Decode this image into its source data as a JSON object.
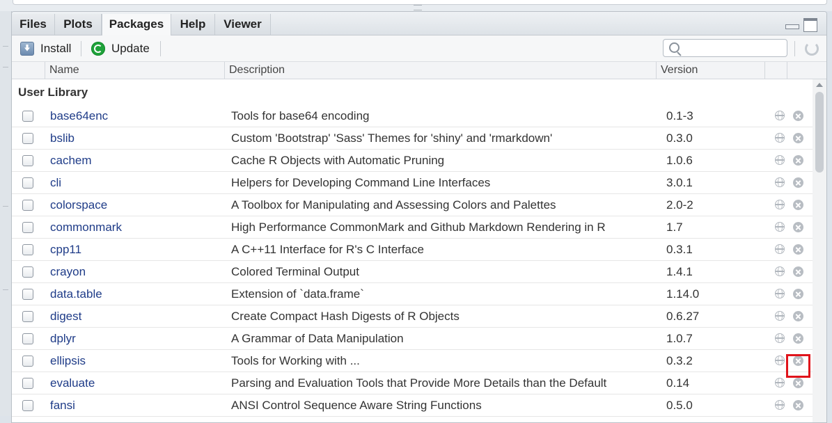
{
  "tabs": [
    "Files",
    "Plots",
    "Packages",
    "Help",
    "Viewer"
  ],
  "active_tab": "Packages",
  "toolbar": {
    "install_label": "Install",
    "update_label": "Update",
    "search_placeholder": ""
  },
  "columns": {
    "name": "Name",
    "description": "Description",
    "version": "Version"
  },
  "library_label": "User Library",
  "packages": [
    {
      "name": "base64enc",
      "description": "Tools for base64 encoding",
      "version": "0.1-3"
    },
    {
      "name": "bslib",
      "description": "Custom 'Bootstrap' 'Sass' Themes for 'shiny' and 'rmarkdown'",
      "version": "0.3.0"
    },
    {
      "name": "cachem",
      "description": "Cache R Objects with Automatic Pruning",
      "version": "1.0.6"
    },
    {
      "name": "cli",
      "description": "Helpers for Developing Command Line Interfaces",
      "version": "3.0.1"
    },
    {
      "name": "colorspace",
      "description": "A Toolbox for Manipulating and Assessing Colors and Palettes",
      "version": "2.0-2"
    },
    {
      "name": "commonmark",
      "description": "High Performance CommonMark and Github Markdown Rendering in R",
      "version": "1.7"
    },
    {
      "name": "cpp11",
      "description": "A C++11 Interface for R's C Interface",
      "version": "0.3.1"
    },
    {
      "name": "crayon",
      "description": "Colored Terminal Output",
      "version": "1.4.1"
    },
    {
      "name": "data.table",
      "description": "Extension of `data.frame`",
      "version": "1.14.0"
    },
    {
      "name": "digest",
      "description": "Create Compact Hash Digests of R Objects",
      "version": "0.6.27"
    },
    {
      "name": "dplyr",
      "description": "A Grammar of Data Manipulation",
      "version": "1.0.7"
    },
    {
      "name": "ellipsis",
      "description": "Tools for Working with ...",
      "version": "0.3.2"
    },
    {
      "name": "evaluate",
      "description": "Parsing and Evaluation Tools that Provide More Details than the Default",
      "version": "0.14"
    },
    {
      "name": "fansi",
      "description": "ANSI Control Sequence Aware String Functions",
      "version": "0.5.0"
    }
  ],
  "icons": {
    "install": "install-icon",
    "update": "update-icon",
    "search": "search-icon",
    "refresh": "refresh-icon",
    "website": "globe-icon",
    "remove": "remove-icon"
  },
  "colors": {
    "package_link": "#1f3c88",
    "update_green": "#1fa23a",
    "highlight": "#e0141b"
  }
}
